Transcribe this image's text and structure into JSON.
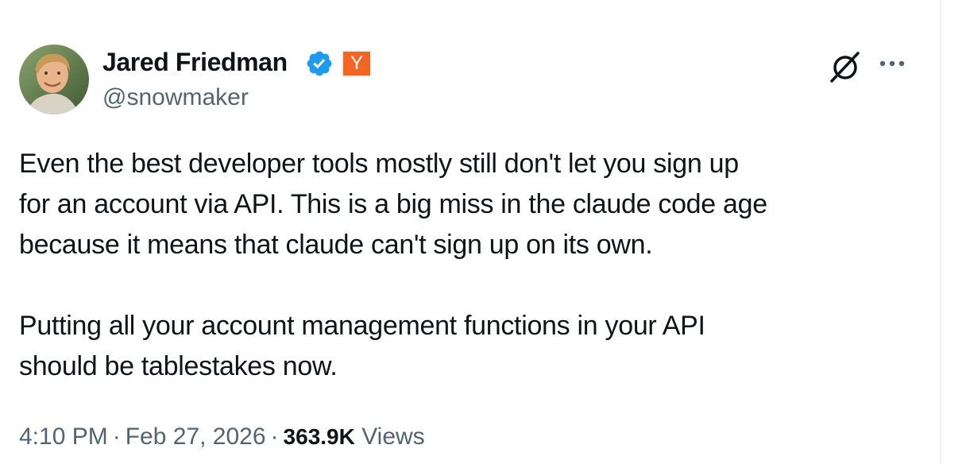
{
  "author": {
    "display_name": "Jared Friedman",
    "handle": "@snowmaker",
    "verified": true,
    "affiliation_badge": "Y",
    "affiliation_color": "#f26522",
    "verified_color": "#1d9bf0"
  },
  "tweet": {
    "paragraphs": [
      [
        "Even the best developer tools mostly still don't let you sign up",
        "for an account via API.  This is a big miss in the claude code age",
        "because it means that claude can't sign up on its own."
      ],
      [
        "Putting all your account management functions in your API",
        "should be tablestakes now."
      ]
    ]
  },
  "meta": {
    "time": "4:10 PM",
    "separator": "·",
    "date": "Feb 27, 2026",
    "views_count": "363.9K",
    "views_label": "Views"
  },
  "icons": {
    "grok": "grok-icon",
    "more": "more-options-icon",
    "verified": "verified-badge-icon"
  },
  "colors": {
    "text": "#0f1419",
    "secondary": "#536471"
  }
}
